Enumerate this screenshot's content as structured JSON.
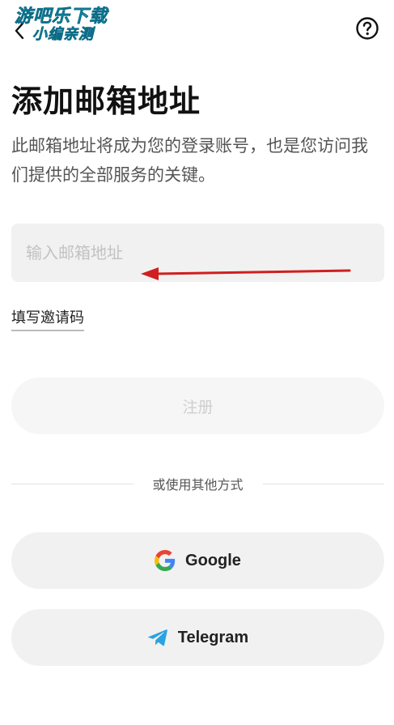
{
  "header": {
    "back_icon": "chevron-left-icon",
    "help_icon": "question-circle-icon",
    "watermark_line1": "游吧乐下载",
    "watermark_line2": "小编亲测"
  },
  "title": "添加邮箱地址",
  "subtitle": "此邮箱地址将成为您的登录账号，也是您访问我们提供的全部服务的关键。",
  "email": {
    "placeholder": "输入邮箱地址",
    "value": ""
  },
  "invite_link": "填写邀请码",
  "register_label": "注册",
  "divider_text": "或使用其他方式",
  "social": {
    "google_label": "Google",
    "google_icon": "google-icon",
    "telegram_label": "Telegram",
    "telegram_icon": "telegram-icon"
  },
  "colors": {
    "accent_arrow": "#d01f1f",
    "telegram_blue": "#2aa3e0",
    "input_bg": "#f1f1f1",
    "disabled_text": "#cfcfcf"
  }
}
